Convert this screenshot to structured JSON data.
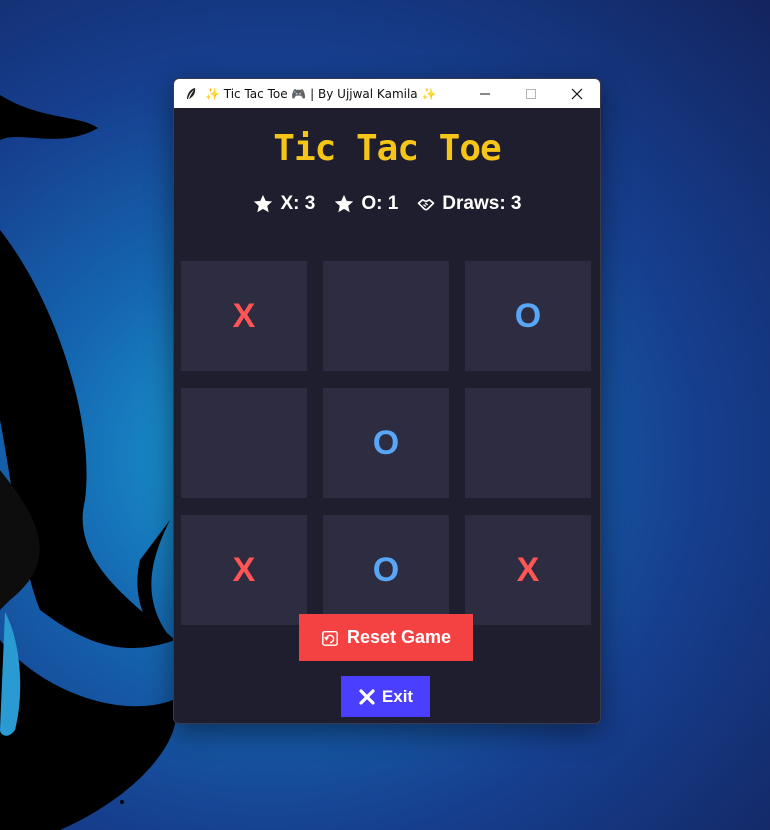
{
  "window": {
    "title": "✨ Tic Tac Toe 🎮 | By Ujjwal Kamila ✨",
    "controls": [
      "minimize-icon",
      "maximize-icon",
      "close-icon"
    ]
  },
  "app": {
    "heading": "Tic Tac Toe"
  },
  "scores": {
    "x": "X: 3",
    "o": "O: 1",
    "draws": "Draws: 3",
    "x_icon": "star-icon",
    "o_icon": "star-icon",
    "draws_icon": "handshake-icon"
  },
  "board": {
    "cells": [
      "X",
      "",
      "O",
      "",
      "O",
      "",
      "X",
      "O",
      "X"
    ]
  },
  "buttons": {
    "reset_label": "Reset Game",
    "reset_icon": "reset-icon",
    "exit_label": "Exit",
    "exit_icon": "x-mark-icon"
  },
  "colors": {
    "background": "#1f1e2e",
    "cell": "#2d2c40",
    "title": "#f5c518",
    "x_mark": "#ff5555",
    "o_mark": "#59a6f7",
    "reset_button": "#f44141",
    "exit_button": "#4a3fff"
  }
}
